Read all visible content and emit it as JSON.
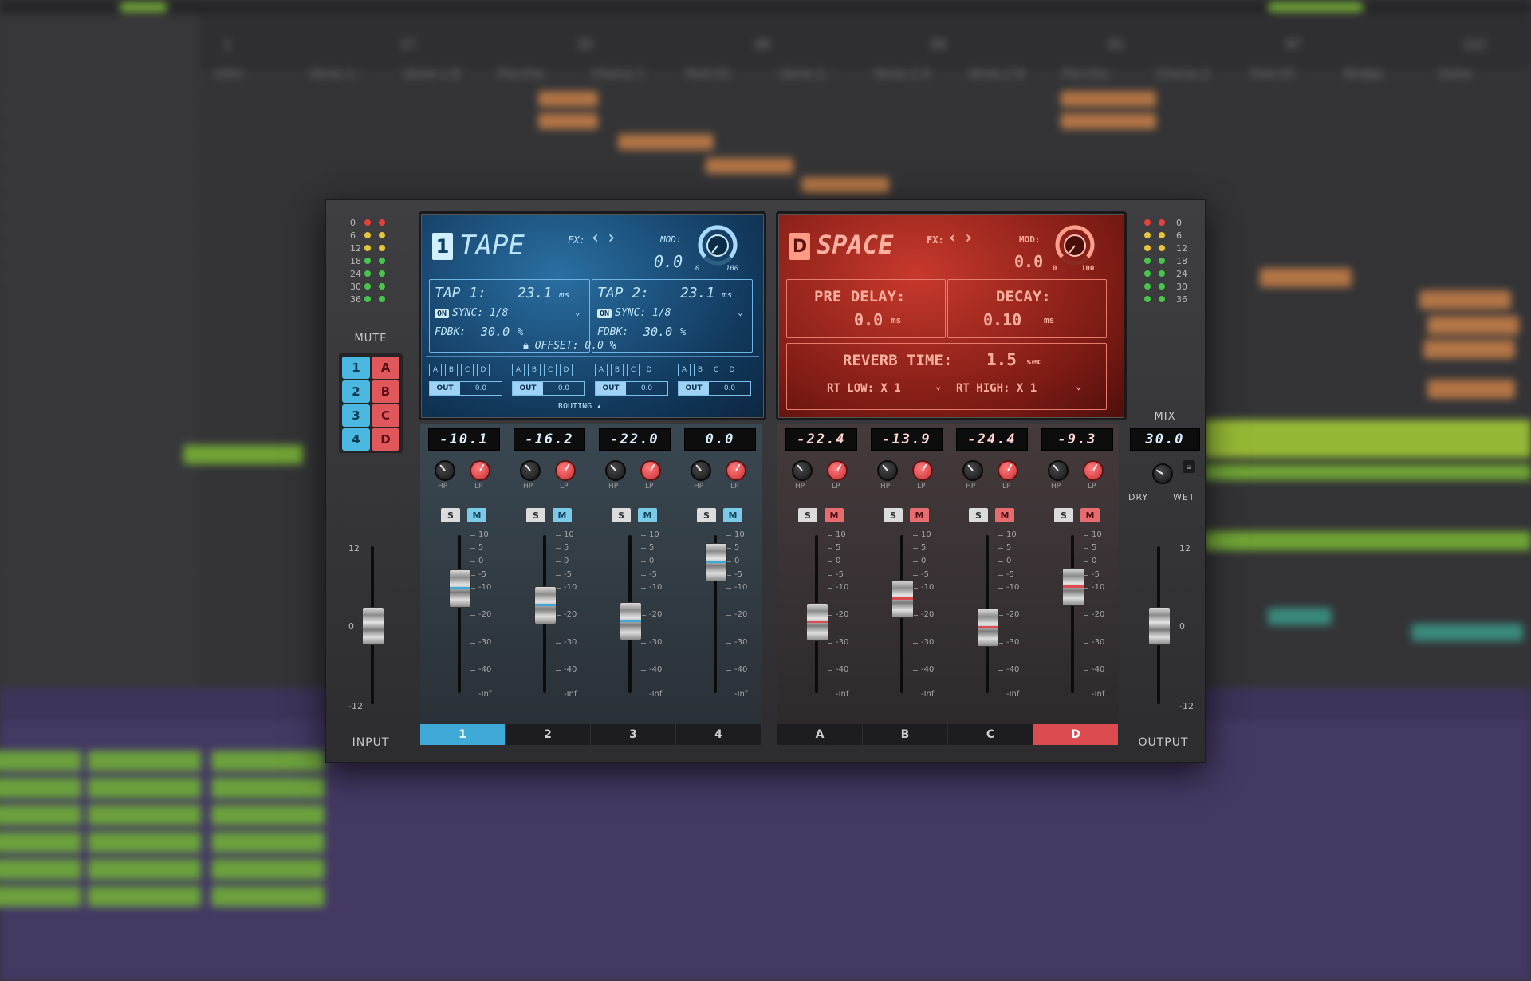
{
  "daw": {
    "ruler": [
      "1",
      "17",
      "33",
      "49",
      "65",
      "81",
      "97",
      "113"
    ],
    "markers": [
      "Intro",
      "Verse 1 –",
      "Verse 1 B",
      "Pre-Cho",
      "Chorus 1",
      "Post-Ch",
      "Verse 2 –",
      "Verse 2 A",
      "Verse 2 B",
      "Pre-Cho",
      "Chorus 2",
      "Post-Ch",
      "Bridge",
      "Outro"
    ]
  },
  "plugin": {
    "input": {
      "label": "INPUT",
      "meter_scale": [
        "0",
        "6",
        "12",
        "18",
        "24",
        "30",
        "36"
      ],
      "fader_scale": [
        "12",
        "0",
        "-12"
      ],
      "fader_level": 0.5
    },
    "output": {
      "label": "OUTPUT",
      "meter_scale": [
        "0",
        "6",
        "12",
        "18",
        "24",
        "30",
        "36"
      ],
      "fader_scale": [
        "12",
        "0",
        "-12"
      ],
      "fader_level": 0.5
    },
    "mute": {
      "label": "MUTE",
      "tape_buttons": [
        "1",
        "2",
        "3",
        "4"
      ],
      "space_buttons": [
        "A",
        "B",
        "C",
        "D"
      ]
    },
    "mix": {
      "label": "MIX",
      "value": "30.0",
      "dry_label": "DRY",
      "wet_label": "WET"
    },
    "tape": {
      "slot": "1",
      "name": "TAPE",
      "fx_label": "FX:",
      "mod_label": "MOD:",
      "mod_value": "0.0",
      "mod_min": "0",
      "mod_max": "100",
      "tap1": {
        "label": "TAP 1:",
        "value": "23.1",
        "unit": "ms",
        "on": "ON",
        "sync": "SYNC: 1/8",
        "fdbk_label": "FDBK:",
        "fdbk": "30.0",
        "fdbk_unit": "%"
      },
      "tap2": {
        "label": "TAP 2:",
        "value": "23.1",
        "unit": "ms",
        "on": "ON",
        "sync": "SYNC: 1/8",
        "fdbk_label": "FDBK:",
        "fdbk": "30.0",
        "fdbk_unit": "%"
      },
      "offset_label": "OFFSET:",
      "offset": "0.0",
      "offset_unit": "%",
      "routing_label": "ROUTING",
      "route_letters": [
        "A",
        "B",
        "C",
        "D"
      ],
      "out_label": "OUT",
      "out_value": "0.0"
    },
    "space": {
      "slot": "D",
      "name": "SPACE",
      "fx_label": "FX:",
      "mod_label": "MOD:",
      "mod_value": "0.0",
      "mod_min": "0",
      "mod_max": "100",
      "pre_delay_label": "PRE DELAY:",
      "pre_delay": "0.0",
      "pre_delay_unit": "ms",
      "decay_label": "DECAY:",
      "decay": "0.10",
      "decay_unit": "ms",
      "reverb_time_label": "REVERB TIME:",
      "reverb_time": "1.5",
      "reverb_time_unit": "sec",
      "rt_low": "RT LOW: X 1",
      "rt_high": "RT HIGH: X 1"
    },
    "knob_labels": {
      "hp": "HP",
      "lp": "LP"
    },
    "solo_label": "S",
    "mute_label": "M",
    "fader_scale": [
      "10",
      "5",
      "0",
      "-5",
      "-10",
      "-20",
      "-30",
      "-40",
      "-Inf"
    ],
    "channels": [
      {
        "tab": "1",
        "readout": "-10.1",
        "group": "tape",
        "level_db": -10.1
      },
      {
        "tab": "2",
        "readout": "-16.2",
        "group": "tape",
        "level_db": -16.2
      },
      {
        "tab": "3",
        "readout": "-22.0",
        "group": "tape",
        "level_db": -22.0
      },
      {
        "tab": "4",
        "readout": "0.0",
        "group": "tape",
        "level_db": 0.0
      },
      {
        "tab": "A",
        "readout": "-22.4",
        "group": "space",
        "level_db": -22.4
      },
      {
        "tab": "B",
        "readout": "-13.9",
        "group": "space",
        "level_db": -13.9
      },
      {
        "tab": "C",
        "readout": "-24.4",
        "group": "space",
        "level_db": -24.4
      },
      {
        "tab": "D",
        "readout": "-9.3",
        "group": "space",
        "level_db": -9.3
      }
    ],
    "selected_tabs": [
      "1",
      "D"
    ],
    "colors": {
      "tape_accent": "#3fa9d8",
      "space_accent": "#dc4b4f"
    }
  }
}
